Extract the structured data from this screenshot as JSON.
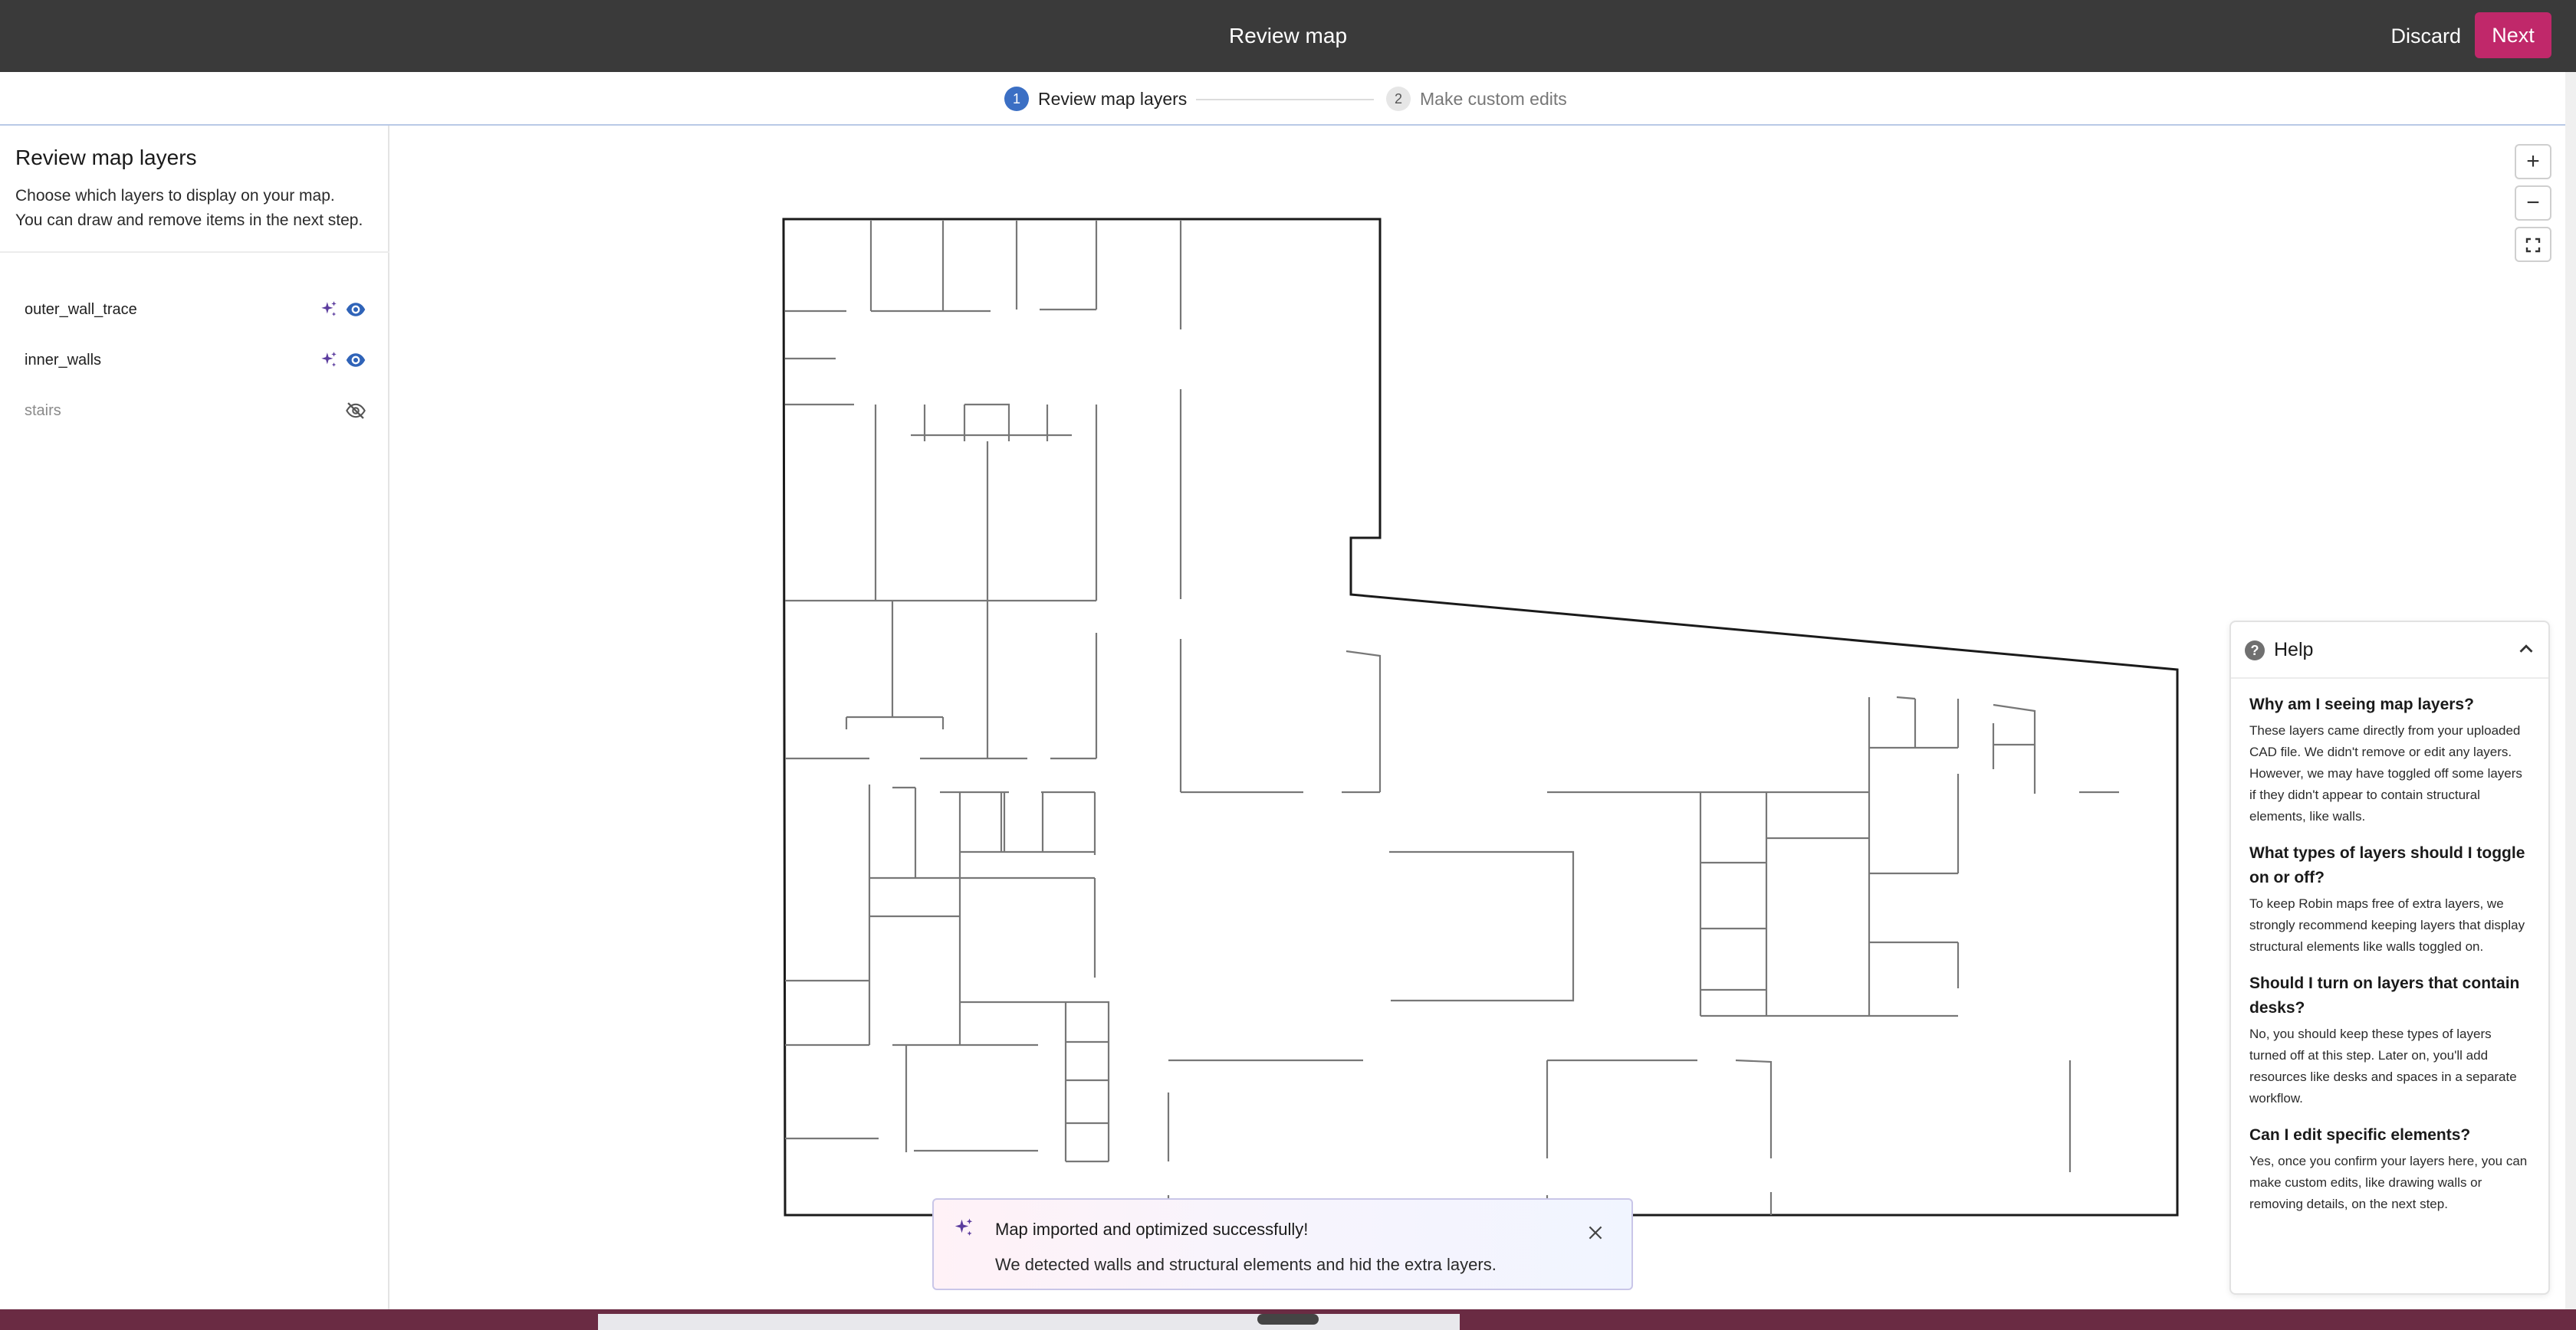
{
  "topbar": {
    "title": "Review map",
    "discard_label": "Discard",
    "next_label": "Next",
    "accent_color": "#c0286a"
  },
  "stepper": {
    "steps": [
      {
        "number": "1",
        "label": "Review map layers",
        "state": "active"
      },
      {
        "number": "2",
        "label": "Make custom edits",
        "state": "inactive"
      }
    ]
  },
  "sidebar": {
    "title": "Review map layers",
    "description_line1": "Choose which layers to display on your map.",
    "description_line2": "You can draw and remove items in the next step.",
    "layers": [
      {
        "name": "outer_wall_trace",
        "visible": true,
        "ai_detected": true,
        "icon": "eye-icon"
      },
      {
        "name": "inner_walls",
        "visible": true,
        "ai_detected": true,
        "icon": "eye-icon"
      },
      {
        "name": "stairs",
        "visible": false,
        "ai_detected": false,
        "icon": "eye-off-icon"
      }
    ]
  },
  "map_controls": {
    "zoom_in": "+",
    "zoom_out": "−",
    "fullscreen_icon": "fullscreen-icon"
  },
  "help": {
    "title": "Help",
    "items": [
      {
        "question": "Why am I seeing map layers?",
        "answer": "These layers came directly from your uploaded CAD file. We didn't remove or edit any layers. However, we may have toggled off some layers if they didn't appear to contain structural elements, like walls."
      },
      {
        "question": "What types of layers should I toggle on or off?",
        "answer": "To keep Robin maps free of extra layers, we strongly recommend keeping layers that display structural elements like walls toggled on."
      },
      {
        "question": "Should I turn on layers that contain desks?",
        "answer": "No, you should keep these types of layers turned off at this step. Later on, you'll add resources like desks and spaces in a separate workflow."
      },
      {
        "question": "Can I edit specific elements?",
        "answer": "Yes, once you confirm your layers here, you can make custom edits, like drawing walls or removing details, on the next step."
      }
    ]
  },
  "toast": {
    "title": "Map imported and optimized successfully!",
    "message": "We detected walls and structural elements and hid the extra layers."
  },
  "colors": {
    "topbar_bg": "#3a3a3a",
    "step_active": "#3b6fc4",
    "eye_icon": "#2f63b8",
    "sparkle_icon": "#5b3c9e"
  }
}
